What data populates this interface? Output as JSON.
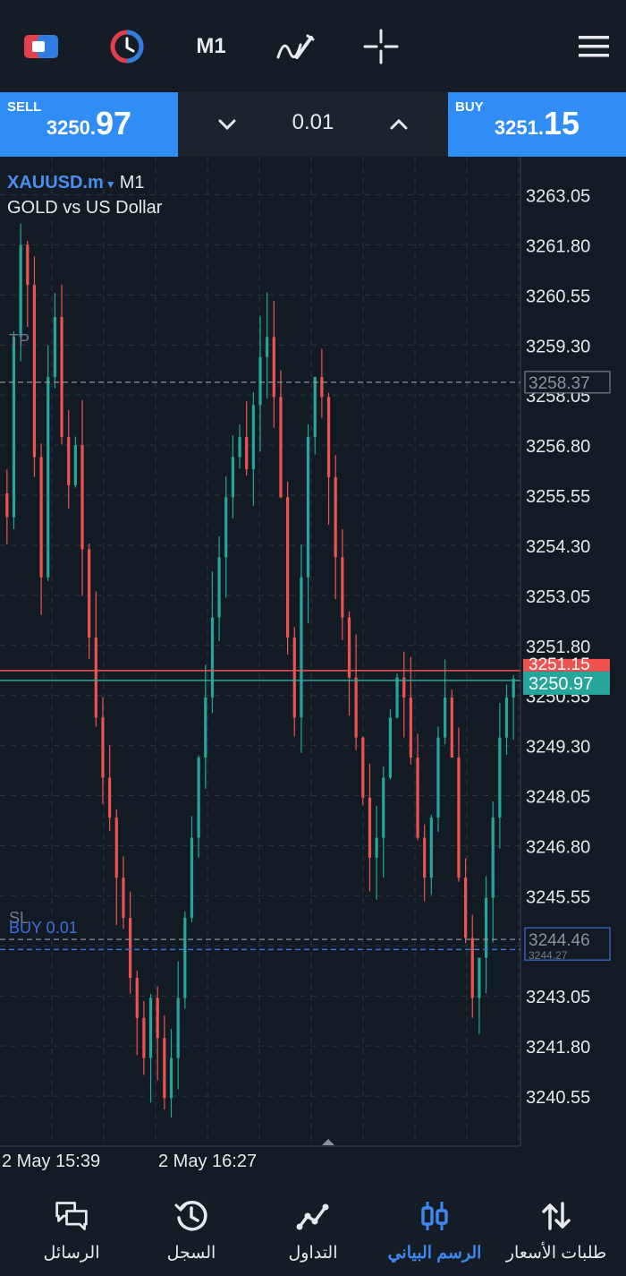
{
  "toolbar": {
    "timeframe": "M1"
  },
  "trade": {
    "sell_label": "SELL",
    "sell_price_small": "3250.",
    "sell_price_big": "97",
    "buy_label": "BUY",
    "buy_price_small": "3251.",
    "buy_price_big": "15",
    "lot": "0.01"
  },
  "chart": {
    "symbol": "XAUUSD.m",
    "symbol_timeframe": "M1",
    "description": "GOLD vs US Dollar",
    "tp_label": "TP",
    "sl_label": "SL",
    "position_label": "BUY 0.01",
    "colors": {
      "bull": "#26a69a",
      "bear": "#ef5350",
      "bid_line": "#26a69a",
      "ask_line": "#ef5350",
      "position_line": "#3f6fd6"
    }
  },
  "chart_data": {
    "type": "candlestick",
    "ylim": [
      3239.3,
      3264.0
    ],
    "yticks": [
      "3263.05",
      "3261.80",
      "3260.55",
      "3259.30",
      "3258.05",
      "3256.80",
      "3255.55",
      "3254.30",
      "3253.05",
      "3251.80",
      "3250.55",
      "3249.30",
      "3248.05",
      "3246.80",
      "3245.55",
      "3244.30",
      "3243.05",
      "3241.80",
      "3240.55"
    ],
    "x_labels": [
      "2 May 15:39",
      "2 May 16:27"
    ],
    "bid": 3250.97,
    "ask": 3251.15,
    "bid_label": "3250.97",
    "ask_label": "3251.15",
    "tp": 3258.37,
    "tp_label": "3258.37",
    "sl": 3244.46,
    "sl_label": "3244.46",
    "entry": 3244.3,
    "entry_label": "3244.27",
    "grid": true,
    "close_path": [
      3255.0,
      3259.5,
      3261.8,
      3260.8,
      3256.5,
      3253.5,
      3258.5,
      3260.0,
      3257.0,
      3255.8,
      3256.8,
      3254.2,
      3252.0,
      3250.0,
      3248.5,
      3247.5,
      3246.0,
      3245.0,
      3243.5,
      3242.5,
      3241.5,
      3243.0,
      3242.0,
      3240.5,
      3241.5,
      3243.0,
      3245.0,
      3247.0,
      3249.0,
      3250.5,
      3252.5,
      3254.0,
      3255.5,
      3256.5,
      3257.0,
      3256.2,
      3257.8,
      3259.0,
      3259.5,
      3258.0,
      3255.5,
      3252.0,
      3250.0,
      3253.5,
      3257.0,
      3258.5,
      3258.0,
      3256.0,
      3254.0,
      3252.5,
      3251.0,
      3249.5,
      3248.0,
      3246.5,
      3247.0,
      3248.5,
      3250.0,
      3251.0,
      3250.5,
      3249.0,
      3247.0,
      3246.0,
      3247.5,
      3249.5,
      3250.5,
      3249.0,
      3246.0,
      3244.5,
      3243.0,
      3244.0,
      3245.5,
      3247.5,
      3249.5,
      3250.5,
      3250.97
    ]
  },
  "nav": {
    "items": [
      {
        "label": "الرسائل",
        "icon": "chat-icon"
      },
      {
        "label": "السجل",
        "icon": "history-icon"
      },
      {
        "label": "التداول",
        "icon": "trade-icon"
      },
      {
        "label": "الرسم البياني",
        "icon": "candles-icon"
      },
      {
        "label": "طلبات الأسعار",
        "icon": "quotes-icon"
      }
    ]
  }
}
